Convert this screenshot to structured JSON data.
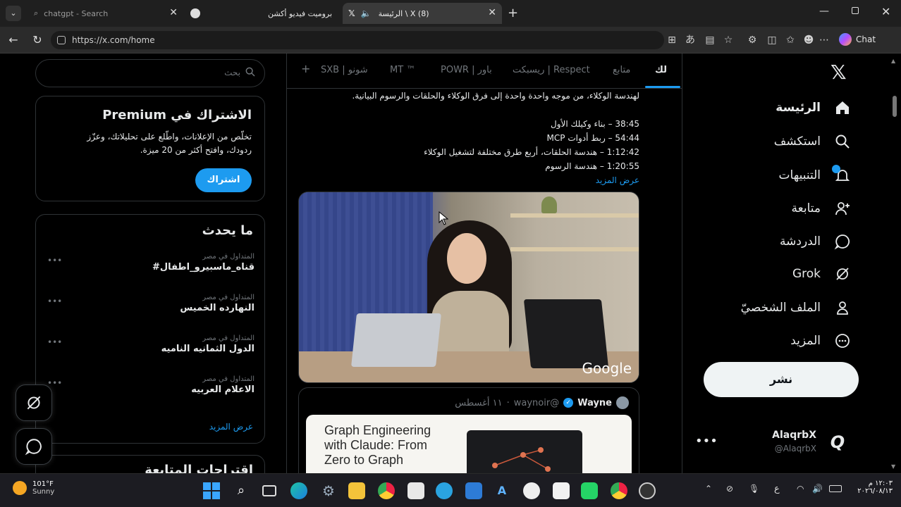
{
  "browser": {
    "tabs": [
      {
        "title": "chatgpt - Search"
      },
      {
        "title": "بروميت فيديو أكشن"
      },
      {
        "title": "الرئيسة \\ X (8)"
      }
    ],
    "url": "https://x.com/home",
    "chat_label": "Chat"
  },
  "nav": {
    "items": [
      {
        "label": "الرئيسة"
      },
      {
        "label": "استكشف"
      },
      {
        "label": "التنبيهات"
      },
      {
        "label": "متابعة"
      },
      {
        "label": "الدردشة"
      },
      {
        "label": "Grok"
      },
      {
        "label": "الملف الشخصيّ"
      },
      {
        "label": "المزيد"
      }
    ],
    "post_button": "نشر",
    "user": {
      "name": "AlaqrbX",
      "handle": "@AlaqrbX"
    }
  },
  "center": {
    "tabs": [
      "لك",
      "متابع",
      "ريسبكت | Respect",
      "POWR | باور",
      "MT ™",
      "SXB | شونو"
    ],
    "tweet_lines": [
      "لهندسة الوكلاء، من موجه واحدة واحدة إلى فرق الوكلاء والحلقات والرسوم البيانية.",
      "38:45 – بناء وكيلك الأول",
      "54:44 – ربط أدوات MCP",
      "1:12:42 – هندسة الحلقات، أربع طرق مختلفة لتشغيل الوكلاء",
      "1:20:55 – هندسة الرسوم"
    ],
    "show_more": "عرض المزيد",
    "video_logo": "Google",
    "tweet2": {
      "author": "Wayne",
      "handle": "@waynoir",
      "date": "١١ أغسطس",
      "card_title_line1": "Graph Engineering",
      "card_title_line2": "with Claude: From",
      "card_title_line3": "Zero to Graph"
    }
  },
  "left": {
    "search_placeholder": "بحث",
    "premium": {
      "title": "الاشتراك في Premium",
      "body_line1": "تخلّص من الإعلانات، واطّلع على تحليلاتك، وعزّز",
      "body_line2": "ردودك، وافتح أكثر من 20 ميزة.",
      "button": "اشتراك"
    },
    "trending": {
      "title": "ما يحدث",
      "items": [
        {
          "context": "المتداول في مصر",
          "topic": "#قناه_ماسبيرو_اطفال"
        },
        {
          "context": "المتداول في مصر",
          "topic": "النهارده الخميس"
        },
        {
          "context": "المتداول في مصر",
          "topic": "الدول الثمانيه الناميه"
        },
        {
          "context": "المتداول في مصر",
          "topic": "الاعلام العربيه"
        }
      ],
      "show_more": "عرض المزيد"
    },
    "follow_title": "اقتراحات المتابعة"
  },
  "taskbar": {
    "weather_temp": "101°F",
    "weather_desc": "Sunny",
    "time": "١٢:٠٣ م",
    "date": "٢٠٢٦/٠٨/١٣",
    "lang": "ع"
  },
  "colors": {
    "accent": "#1d9bf0",
    "background": "#000000",
    "border": "#2f3336",
    "muted": "#71767b"
  }
}
